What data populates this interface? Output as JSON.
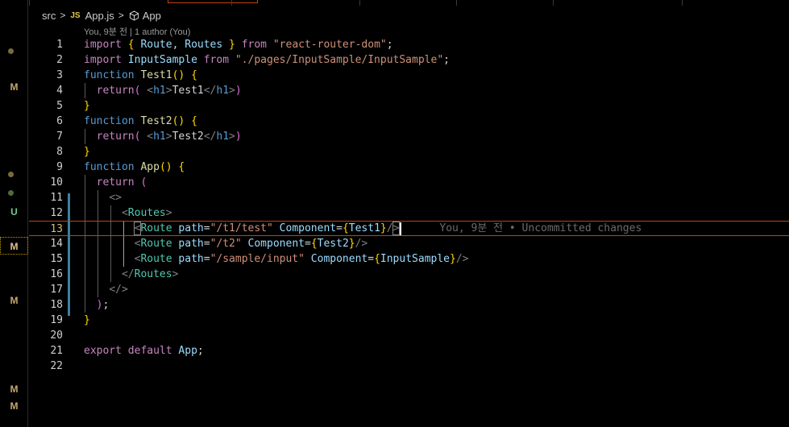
{
  "breadcrumb": {
    "folder": "src",
    "file_badge": "JS",
    "file": "App.js",
    "symbol": "App"
  },
  "codelens": "You, 9분 전 | 1 author (You)",
  "current_line": 13,
  "blame": "You, 9분 전 • Uncommitted changes",
  "scm_markers": [
    "M",
    "U",
    "M",
    "M",
    "M",
    "M"
  ],
  "code_lines": [
    "import { Route, Routes } from \"react-router-dom\";",
    "import InputSample from \"./pages/InputSample/InputSample\";",
    "function Test1() {",
    "  return( <h1>Test1</h1>)",
    "}",
    "function Test2() {",
    "  return( <h1>Test2</h1>)",
    "}",
    "function App() {",
    "  return (",
    "    <>",
    "      <Routes>",
    "        <Route path=\"/t1/test\" Component={Test1}/>",
    "        <Route path=\"/t2\" Component={Test2}/>",
    "        <Route path=\"/sample/input\" Component={InputSample}/>",
    "      </Routes>",
    "    </>",
    "  );",
    "}",
    "",
    "export default App;",
    ""
  ],
  "colors": {
    "keyword": "#569cd6",
    "control": "#c586c0",
    "string": "#ce9178",
    "variable": "#9cdcfe",
    "tag": "#4ec9b0",
    "current_line_border": "#c1440e",
    "modified_gutter": "#3f7fa0"
  }
}
